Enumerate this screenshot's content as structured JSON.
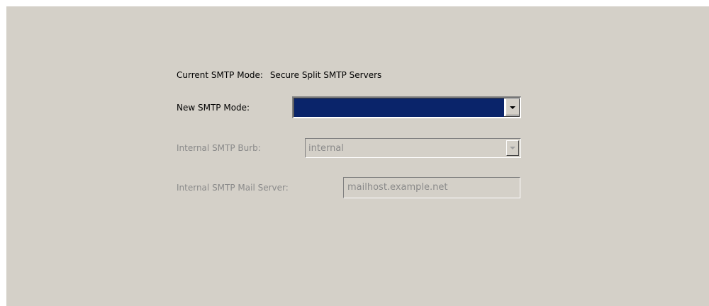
{
  "form": {
    "current_mode": {
      "label": "Current SMTP Mode:",
      "value": "Secure Split SMTP Servers"
    },
    "new_mode": {
      "label": "New SMTP Mode:",
      "selected_value": ""
    },
    "internal_burb": {
      "label": "Internal SMTP Burb:",
      "value": "internal",
      "enabled": false
    },
    "internal_mail_server": {
      "label": "Internal SMTP Mail Server:",
      "value": "mailhost.example.net",
      "enabled": false
    }
  },
  "colors": {
    "background": "#d4d0c8",
    "selection": "#0a246a",
    "disabled_text": "#8a8a8a"
  },
  "icons": {
    "dropdown": "chevron-down-icon"
  }
}
